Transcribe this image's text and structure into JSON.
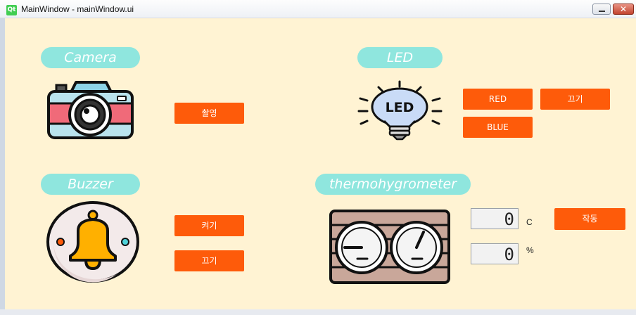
{
  "window": {
    "title": "MainWindow - mainWindow.ui",
    "logo": "Qt",
    "close_glyph": "✕"
  },
  "camera": {
    "title": "Camera",
    "capture_label": "촬영"
  },
  "led": {
    "title": "LED",
    "icon_text": "LED",
    "red_label": "RED",
    "off_label": "끄기",
    "blue_label": "BLUE"
  },
  "buzzer": {
    "title": "Buzzer",
    "on_label": "켜기",
    "off_label": "끄기"
  },
  "thermo": {
    "title": "thermohygrometer",
    "temperature": "0",
    "temp_unit": "C",
    "humidity": "0",
    "humidity_unit": "%",
    "run_label": "작동"
  },
  "colors": {
    "accent": "#fe5b0a",
    "pill": "#8fe6de",
    "background": "#fff3d3"
  }
}
